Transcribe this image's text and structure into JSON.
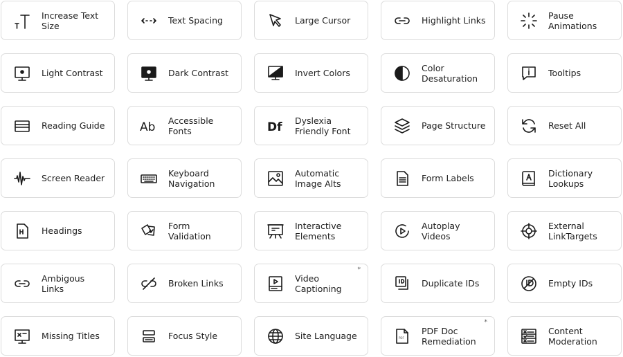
{
  "tools": [
    {
      "label": "Increase Text Size",
      "icon": "text-size-icon"
    },
    {
      "label": "Text Spacing",
      "icon": "text-spacing-icon"
    },
    {
      "label": "Large Cursor",
      "icon": "cursor-icon"
    },
    {
      "label": "Highlight Links",
      "icon": "link-icon"
    },
    {
      "label": "Pause Animations",
      "icon": "loader-icon"
    },
    {
      "label": "Light Contrast",
      "icon": "monitor-light-icon"
    },
    {
      "label": "Dark Contrast",
      "icon": "monitor-dark-icon"
    },
    {
      "label": "Invert Colors",
      "icon": "invert-monitor-icon"
    },
    {
      "label": "Color Desaturation",
      "icon": "half-circle-icon"
    },
    {
      "label": "Tooltips",
      "icon": "info-bubble-icon"
    },
    {
      "label": "Reading Guide",
      "icon": "reading-guide-icon"
    },
    {
      "label": "Accessible Fonts",
      "icon": "font-ab-icon"
    },
    {
      "label": "Dyslexia Friendly Font",
      "icon": "font-df-icon"
    },
    {
      "label": "Page Structure",
      "icon": "layers-icon"
    },
    {
      "label": "Reset All",
      "icon": "refresh-icon"
    },
    {
      "label": "Screen Reader",
      "icon": "sound-wave-icon"
    },
    {
      "label": "Keyboard Navigation",
      "icon": "keyboard-icon"
    },
    {
      "label": "Automatic Image Alts",
      "icon": "image-icon"
    },
    {
      "label": "Form Labels",
      "icon": "document-icon"
    },
    {
      "label": "Dictionary Lookups",
      "icon": "book-icon"
    },
    {
      "label": "Headings",
      "icon": "heading-file-icon"
    },
    {
      "label": "Form Validation",
      "icon": "cards-check-icon"
    },
    {
      "label": "Interactive Elements",
      "icon": "presentation-icon"
    },
    {
      "label": "Autoplay Videos",
      "icon": "play-circle-icon"
    },
    {
      "label": "External LinkTargets",
      "icon": "crosshair-icon"
    },
    {
      "label": "Ambigous Links",
      "icon": "link-icon"
    },
    {
      "label": "Broken Links",
      "icon": "broken-link-icon"
    },
    {
      "label": "Video Captioning",
      "icon": "video-caption-icon",
      "star": "*"
    },
    {
      "label": "Duplicate IDs",
      "icon": "duplicate-icon"
    },
    {
      "label": "Empty IDs",
      "icon": "empty-id-icon"
    },
    {
      "label": "Missing Titles",
      "icon": "missing-title-icon"
    },
    {
      "label": "Focus Style",
      "icon": "focus-style-icon"
    },
    {
      "label": "Site Language",
      "icon": "globe-icon"
    },
    {
      "label": "PDF Doc Remediation",
      "icon": "pdf-file-icon",
      "star": "*"
    },
    {
      "label": "Content Moderation",
      "icon": "checklist-icon"
    }
  ]
}
